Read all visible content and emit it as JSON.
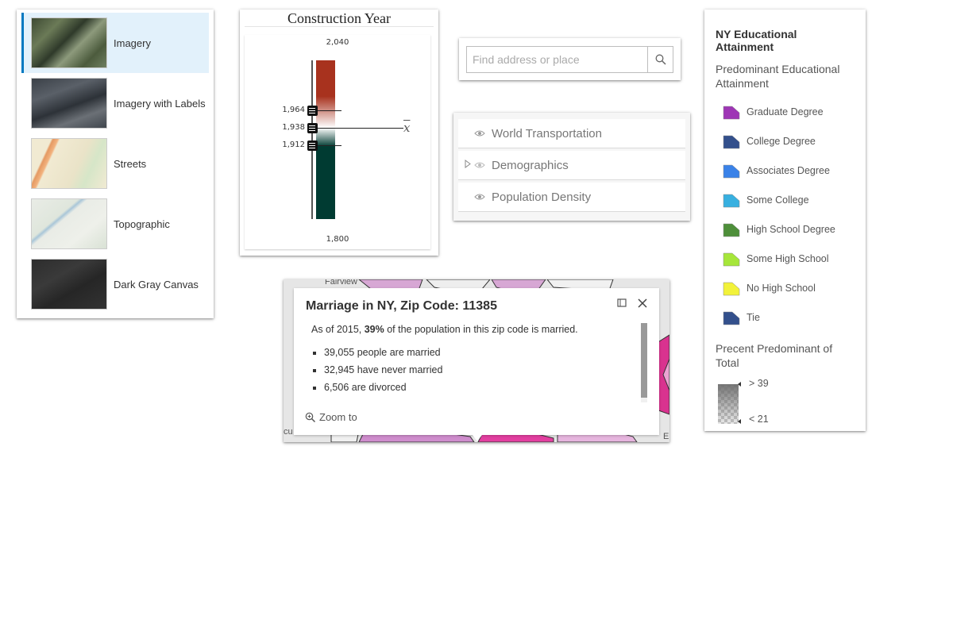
{
  "basemap_gallery": {
    "items": [
      {
        "label": "Imagery",
        "thumb": "imagery-thumbnail",
        "selected": true
      },
      {
        "label": "Imagery with Labels",
        "thumb": "imagery-labels-thumbnail",
        "selected": false
      },
      {
        "label": "Streets",
        "thumb": "streets-thumbnail",
        "selected": false
      },
      {
        "label": "Topographic",
        "thumb": "topographic-thumbnail",
        "selected": false
      },
      {
        "label": "Dark Gray Canvas",
        "thumb": "dark-gray-thumbnail",
        "selected": false
      }
    ]
  },
  "construction_slider": {
    "title": "Construction Year",
    "max": "2,040",
    "min": "1,800",
    "range_max": 2040,
    "range_min": 1800,
    "thumbs": [
      {
        "label": "1,964",
        "value": 1964
      },
      {
        "label": "1,938",
        "value": 1938
      },
      {
        "label": "1,912",
        "value": 1912
      }
    ],
    "average_symbol": "x",
    "colors": {
      "high": "#a8321e",
      "mid": "#ffffff",
      "low": "#003b32"
    }
  },
  "search": {
    "placeholder": "Find address or place",
    "value": "",
    "button_icon": "search-icon"
  },
  "layer_list": {
    "layers": [
      {
        "name": "World Transportation",
        "expandable": false,
        "icon": "eye-icon"
      },
      {
        "name": "Demographics",
        "expandable": true,
        "icon": "eye-icon"
      },
      {
        "name": "Population Density",
        "expandable": false,
        "icon": "eye-icon"
      }
    ]
  },
  "legend": {
    "title": "NY Educational Attainment",
    "subtitle": "Predominant Educational Attainment",
    "items": [
      {
        "label": "Graduate Degree",
        "color": "#9e36b5"
      },
      {
        "label": "College Degree",
        "color": "#33508c"
      },
      {
        "label": "Associates Degree",
        "color": "#3a82e8"
      },
      {
        "label": "Some College",
        "color": "#38b0e0"
      },
      {
        "label": "High School Degree",
        "color": "#4e8f3a"
      },
      {
        "label": "Some High School",
        "color": "#a6e63a"
      },
      {
        "label": "No High School",
        "color": "#f2f23a"
      },
      {
        "label": "Tie",
        "color": "#33508c"
      }
    ],
    "percent_title": "Precent Predominant of Total",
    "percent_high": "> 39",
    "percent_low": "< 21"
  },
  "map": {
    "place_label": "Fairview",
    "edge_label_left": "cu",
    "edge_label_right": "E"
  },
  "popup": {
    "title": "Marriage in NY, Zip Code: 11385",
    "intro_prefix": "As of 2015, ",
    "intro_bold": "39%",
    "intro_suffix": " of the population in this zip code is married.",
    "facts": [
      "39,055 people are married",
      "32,945 have never married",
      "6,506 are divorced"
    ],
    "zoom_label": "Zoom to"
  }
}
